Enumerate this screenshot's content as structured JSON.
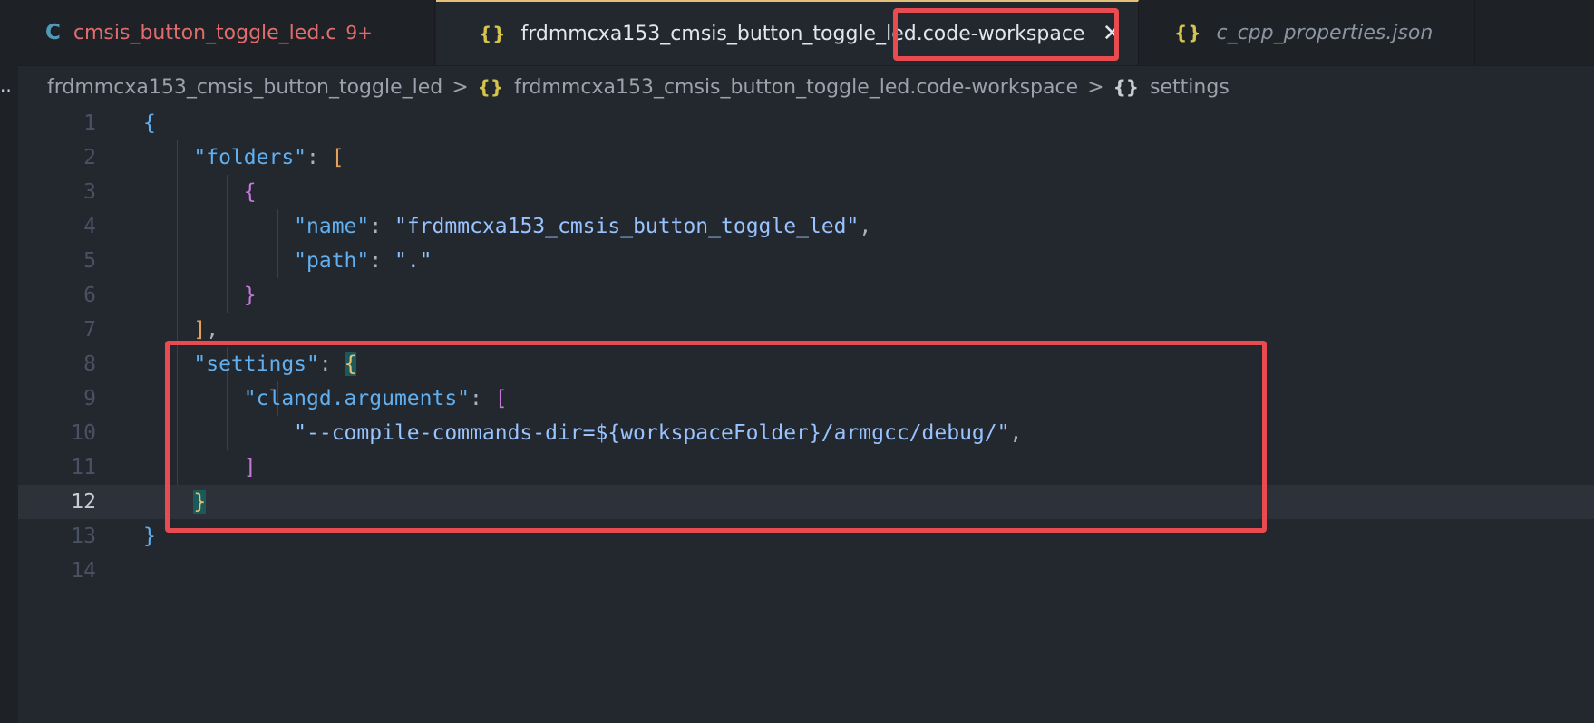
{
  "tabs": [
    {
      "icon": "c-file-icon",
      "icon_glyph": "C",
      "label": "cmsis_button_toggle_led.c",
      "badge": "9+"
    },
    {
      "icon": "json-braces-icon",
      "icon_glyph": "{}",
      "label": "frdmmcxa153_cmsis_button_toggle_led.code-workspace",
      "close_glyph": "✕"
    },
    {
      "icon": "json-braces-icon",
      "icon_glyph": "{}",
      "label": "c_cpp_properties.json"
    }
  ],
  "breadcrumb": {
    "folder": "frdmmcxa153_cmsis_button_toggle_led",
    "separator": ">",
    "file_icon": "{}",
    "file": "frdmmcxa153_cmsis_button_toggle_led.code-workspace",
    "symbol_icon": "{}",
    "symbol": "settings"
  },
  "gutter_dots": "..",
  "line_numbers": [
    "1",
    "2",
    "3",
    "4",
    "5",
    "6",
    "7",
    "8",
    "9",
    "10",
    "11",
    "12",
    "13",
    "14"
  ],
  "code": {
    "l1_open": "{",
    "l2_key": "\"folders\"",
    "l2_colon": ": ",
    "l2_open": "[",
    "l3_open": "{",
    "l4_key": "\"name\"",
    "l4_colon": ": ",
    "l4_value": "\"frdmmcxa153_cmsis_button_toggle_led\"",
    "l4_comma": ",",
    "l5_key": "\"path\"",
    "l5_colon": ": ",
    "l5_value": "\".\"",
    "l6_close": "}",
    "l7_close": "]",
    "l7_comma": ",",
    "l8_key": "\"settings\"",
    "l8_colon": ": ",
    "l8_open": "{",
    "l9_key": "\"clangd.arguments\"",
    "l9_colon": ": ",
    "l9_open": "[",
    "l10_value": "\"--compile-commands-dir=${workspaceFolder}/armgcc/debug/\"",
    "l10_comma": ",",
    "l11_close": "]",
    "l12_close": "}",
    "l13_close": "}"
  },
  "current_line": "12",
  "colors": {
    "highlight_box": "#e84b50",
    "editor_bg": "#23272e",
    "active_tab_accent": "#e5c07b"
  }
}
